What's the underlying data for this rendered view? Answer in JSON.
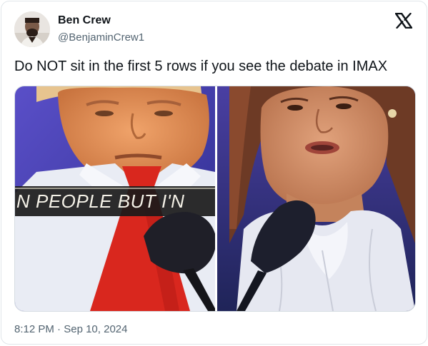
{
  "tweet": {
    "author_name": "Ben Crew",
    "author_handle": "@BenjaminCrew1",
    "text": "Do NOT sit in the first 5 rows if you see the debate in IMAX",
    "time": "8:12 PM",
    "separator": "·",
    "date": "Sep 10, 2024",
    "platform_icon": "x-logo-icon"
  },
  "media": {
    "caption_text": "N PEOPLE BUT I'N"
  },
  "colors": {
    "text_primary": "#0f1419",
    "text_secondary": "#536471",
    "border": "#e1e6ea",
    "tie_red": "#d9271e",
    "backdrop_blue": "#3a3fb0"
  }
}
